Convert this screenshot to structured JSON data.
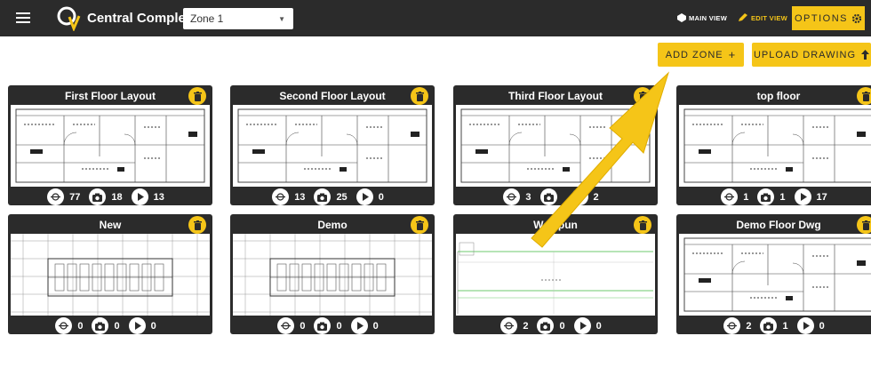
{
  "header": {
    "app_title": "Central Complex",
    "zone_selected": "Zone 1",
    "main_view_label": "MAIN VIEW",
    "edit_view_label": "EDIT VIEW",
    "options_label": "OPTIONS"
  },
  "actions": {
    "add_zone_label": "ADD ZONE",
    "add_zone_glyph": "+",
    "upload_label": "UPLOAD DRAWING",
    "upload_glyph": "🠕"
  },
  "colors": {
    "accent": "#f5c518",
    "bar": "#2b2b2b",
    "drawing_line": "#444444",
    "green_line": "#6ec96e"
  },
  "icons": [
    "menu-icon",
    "logo-icon",
    "eye-icon",
    "pencil-icon",
    "gear-icon",
    "trash-icon",
    "pin-icon",
    "camera-icon",
    "play-icon",
    "arrow-up-icon"
  ],
  "cards": [
    {
      "title": "First Floor Layout",
      "pins": "77",
      "photos": "18",
      "videos": "13"
    },
    {
      "title": "Second Floor Layout",
      "pins": "13",
      "photos": "25",
      "videos": "0"
    },
    {
      "title": "Third Floor Layout",
      "pins": "3",
      "photos": "",
      "videos": "2"
    },
    {
      "title": "top floor",
      "pins": "1",
      "photos": "1",
      "videos": "17"
    },
    {
      "title": "New",
      "pins": "0",
      "photos": "0",
      "videos": "0"
    },
    {
      "title": "Demo",
      "pins": "0",
      "photos": "0",
      "videos": "0"
    },
    {
      "title": "Welspun",
      "pins": "2",
      "photos": "0",
      "videos": "0"
    },
    {
      "title": "Demo Floor Dwg",
      "pins": "2",
      "photos": "1",
      "videos": "0"
    }
  ]
}
